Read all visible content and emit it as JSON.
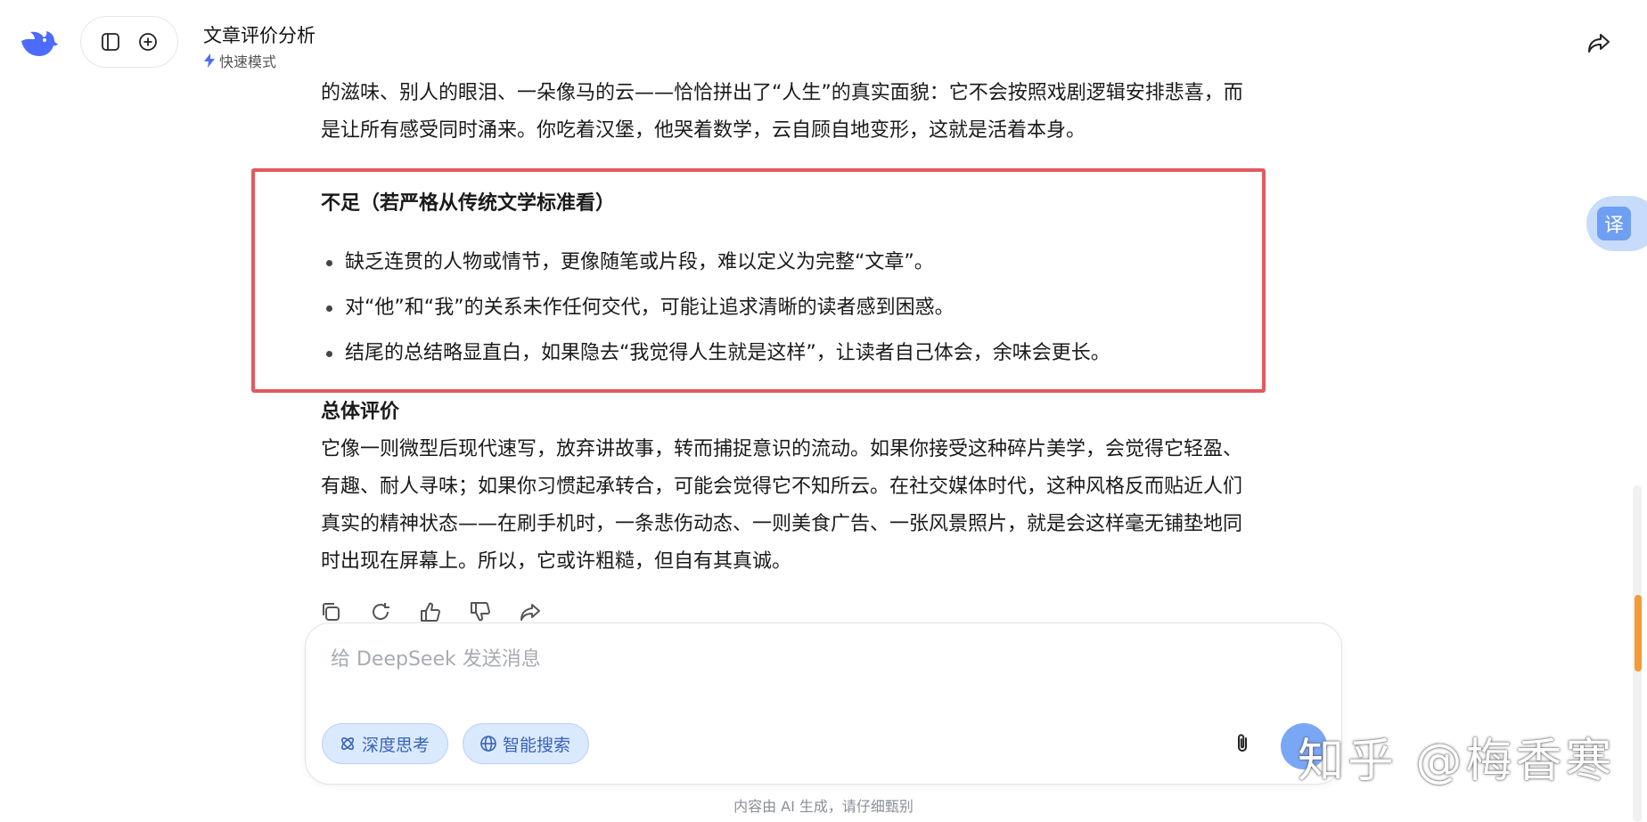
{
  "header": {
    "title": "文章评价分析",
    "mode_label": "快速模式"
  },
  "content": {
    "intro_lines": [
      "的滋味、别人的眼泪、一朵像马的云——恰恰拼出了“人生”的真实面貌：它不会按照戏剧逻辑安排悲喜，而",
      "是让所有感受同时涌来。你吃着汉堡，他哭着数学，云自顾自地变形，这就是活着本身。"
    ],
    "shortcomings_title": "不足（若严格从传统文学标准看）",
    "shortcomings": [
      "缺乏连贯的人物或情节，更像随笔或片段，难以定义为完整“文章”。",
      "对“他”和“我”的关系未作任何交代，可能让追求清晰的读者感到困惑。",
      "结尾的总结略显直白，如果隐去“我觉得人生就是这样”，让读者自己体会，余味会更长。"
    ],
    "overall_title": "总体评价",
    "overall_lines": [
      "它像一则微型后现代速写，放弃讲故事，转而捕捉意识的流动。如果你接受这种碎片美学，会觉得它轻盈、",
      "有趣、耐人寻味；如果你习惯起承转合，可能会觉得它不知所云。在社交媒体时代，这种风格反而贴近人们",
      "真实的精神状态——在刷手机时，一条悲伤动态、一则美食广告、一张风景照片，就是会这样毫无铺垫地同",
      "时出现在屏幕上。所以，它或许粗糙，但自有其真诚。"
    ]
  },
  "composer": {
    "placeholder": "给 DeepSeek 发送消息",
    "deep_think_label": "深度思考",
    "smart_search_label": "智能搜索"
  },
  "footer": {
    "disclaimer": "内容由 AI 生成，请仔细甄别"
  },
  "translate_label": "译",
  "watermark": "知乎 @梅香寒",
  "colors": {
    "accent": "#4d6bfe",
    "highlight_box": "#e05a5f",
    "scroll_thumb": "#f39a3a"
  }
}
